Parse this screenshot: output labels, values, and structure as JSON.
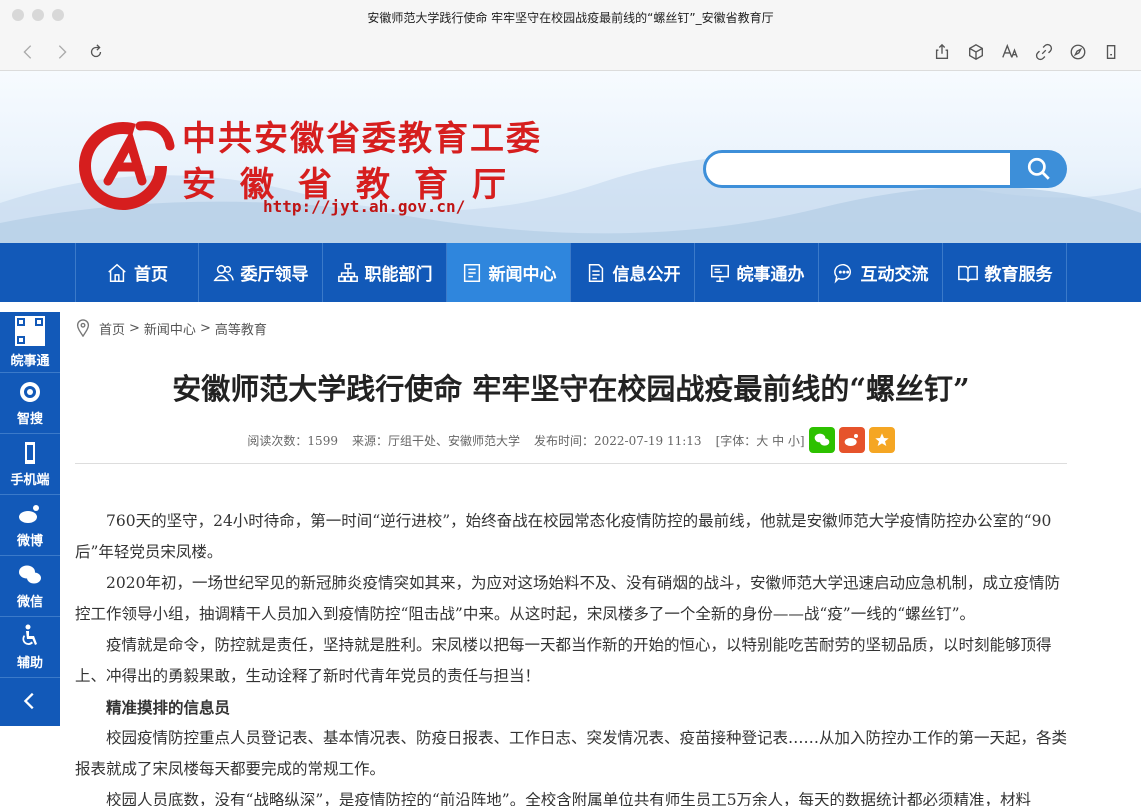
{
  "browser": {
    "window_title": "安徽师范大学践行使命 牢牢坚守在校园战疫最前线的“螺丝钉”_安徽省教育厅",
    "toolbar_icons": [
      "back-icon",
      "forward-icon",
      "reload-icon",
      "share-icon",
      "cube-icon",
      "text-size-icon",
      "link-icon",
      "compass-icon",
      "profile-icon"
    ]
  },
  "header": {
    "org_line1": "中共安徽省委教育工委",
    "org_line2": "安徽省教育厅",
    "url": "http://jyt.ah.gov.cn/",
    "search_placeholder": ""
  },
  "nav": {
    "items": [
      {
        "label": "首页",
        "icon": "home-icon"
      },
      {
        "label": "委厅领导",
        "icon": "people-icon"
      },
      {
        "label": "职能部门",
        "icon": "org-chart-icon"
      },
      {
        "label": "新闻中心",
        "icon": "news-icon",
        "active": true
      },
      {
        "label": "信息公开",
        "icon": "document-icon"
      },
      {
        "label": "皖事通办",
        "icon": "monitor-icon"
      },
      {
        "label": "互动交流",
        "icon": "chat-icon"
      },
      {
        "label": "教育服务",
        "icon": "book-icon"
      }
    ]
  },
  "sidebar": {
    "items": [
      {
        "label": "皖事通",
        "icon": "qr-code-icon"
      },
      {
        "label": "智搜",
        "icon": "smart-search-icon"
      },
      {
        "label": "手机端",
        "icon": "phone-icon"
      },
      {
        "label": "微博",
        "icon": "weibo-icon"
      },
      {
        "label": "微信",
        "icon": "wechat-icon"
      },
      {
        "label": "辅助",
        "icon": "accessibility-icon"
      }
    ]
  },
  "breadcrumb": {
    "items": [
      "首页",
      ">",
      "新闻中心",
      ">",
      "高等教育"
    ]
  },
  "article": {
    "title": "安徽师范大学践行使命 牢牢坚守在校园战疫最前线的“螺丝钉”",
    "meta": {
      "reads": "阅读次数：1599",
      "source": "来源：厅组干处、安徽师范大学",
      "published": "发布时间：2022-07-19 11:13",
      "font_size": "[字体：大 中 小]"
    },
    "share_colors": {
      "wechat": "#2dc100",
      "weibo": "#e6532b",
      "favorite": "#f5a623"
    },
    "paragraphs": [
      {
        "text": "760天的坚守，24小时待命，第一时间“逆行进校”，始终奋战在校园常态化疫情防控的最前线，他就是安徽师范大学疫情防控办公室的“90后”年轻党员宋凤楼。",
        "heading": false
      },
      {
        "text": "2020年初，一场世纪罕见的新冠肺炎疫情突如其来，为应对这场始料不及、没有硝烟的战斗，安徽师范大学迅速启动应急机制，成立疫情防控工作领导小组，抽调精干人员加入到疫情防控“阻击战”中来。从这时起，宋凤楼多了一个全新的身份——战“疫”一线的“螺丝钉”。",
        "heading": false
      },
      {
        "text": "疫情就是命令，防控就是责任，坚持就是胜利。宋凤楼以把每一天都当作新的开始的恒心，以特别能吃苦耐劳的坚韧品质，以时刻能够顶得上、冲得出的勇毅果敢，生动诠释了新时代青年党员的责任与担当！",
        "heading": false
      },
      {
        "text": "精准摸排的信息员",
        "heading": true
      },
      {
        "text": "校园疫情防控重点人员登记表、基本情况表、防疫日报表、工作日志、突发情况表、疫苗接种登记表……从加入防控办工作的第一天起，各类报表就成了宋凤楼每天都要完成的常规工作。",
        "heading": false
      },
      {
        "text": "校园人员底数，没有“战略纵深”，是疫情防控的“前沿阵地”。全校含附属单位共有师生员工5万余人，每天的数据统计都必须精准，材料",
        "heading": false
      }
    ]
  }
}
